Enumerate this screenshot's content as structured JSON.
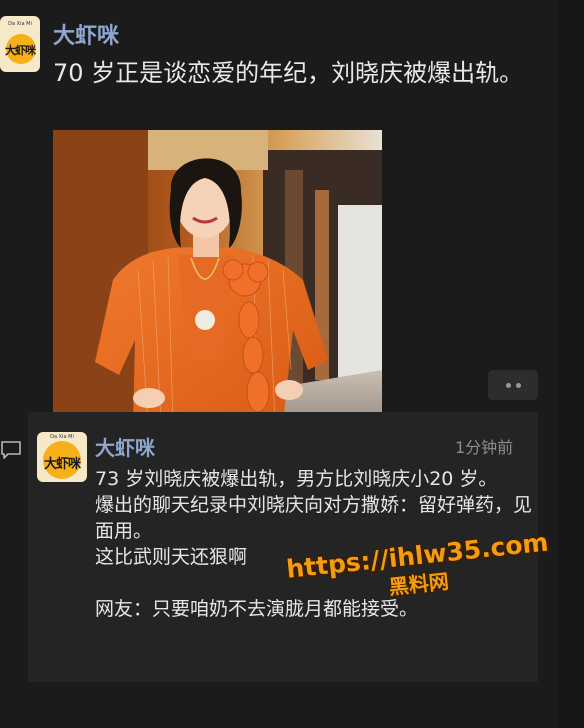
{
  "post": {
    "author": "大虾咪",
    "avatar_logo_text": "大虾咪",
    "avatar_small_text": "Da Xia Mi",
    "text": "70 岁正是谈恋爱的年纪，刘晓庆被爆出轨。",
    "more_icon": "ellipsis-icon"
  },
  "comment": {
    "icon": "comment-icon",
    "author": "大虾咪",
    "timestamp": "1分钟前",
    "lines": [
      "73 岁刘晓庆被爆出轨，男方比刘晓庆小20 岁。",
      "爆出的聊天纪录中刘晓庆向对方撒娇：留好弹药，见面用。",
      "这比武则天还狠啊",
      "网友：只要咱奶不去演胧月都能接受。"
    ]
  },
  "watermark": {
    "url": "https://ihlw35.com",
    "name": "黑料网"
  },
  "colors": {
    "background": "#1b1b1b",
    "author_name": "#8fa7cf",
    "watermark": "#f39c12"
  }
}
